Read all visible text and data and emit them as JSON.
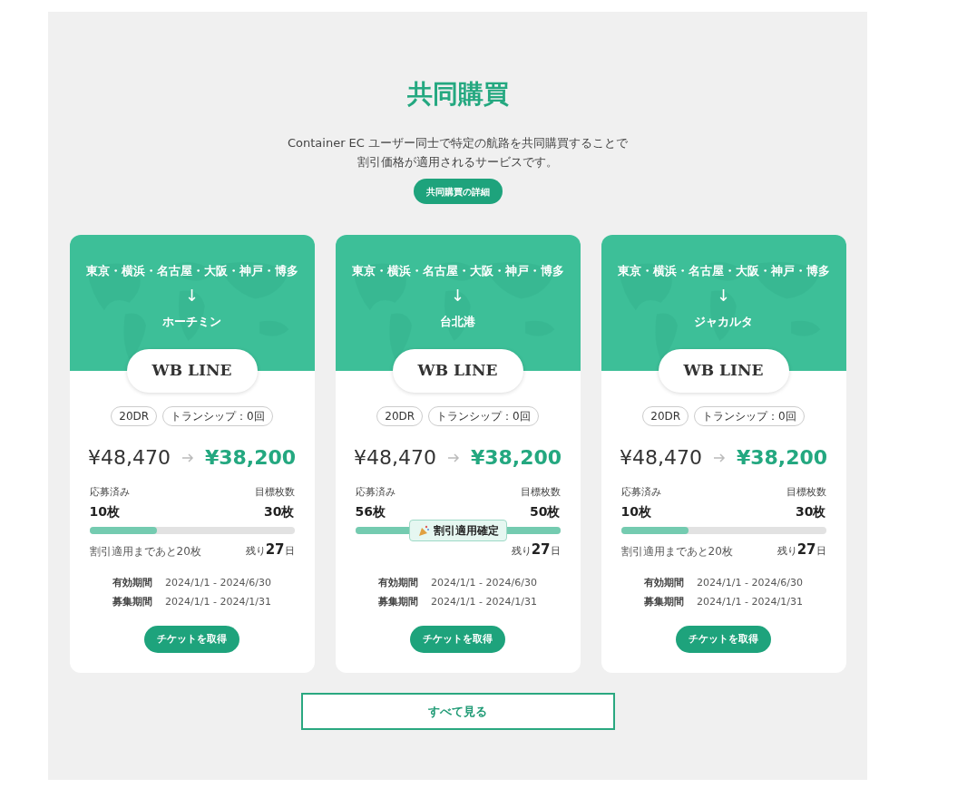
{
  "section": {
    "title": "共同購買",
    "description": [
      "Container EC ユーザー同士で特定の航路を共同購買することで",
      "割引価格が適用されるサービスです。"
    ],
    "detail_button": "共同購買の詳細"
  },
  "cards": [
    {
      "origin": "東京・横浜・名古屋・大阪・神戸・博多",
      "arrow": "↓",
      "destination": "ホーチミン",
      "carrier": "WB LINE",
      "tags": [
        "20DR",
        "トランシップ：0回"
      ],
      "original_price": "¥48,470",
      "discount_price": "¥38,200",
      "applied_label": "応募済み",
      "applied": "10枚",
      "target_label": "目標枚数",
      "target": "30枚",
      "level": 0.33,
      "confirmed": false,
      "remaining_note": "割引適用まであと20枚",
      "days_prefix": "残り",
      "days": "27",
      "days_suffix": "日",
      "periods": [
        {
          "label": "有効期間",
          "value": "2024/1/1 - 2024/6/30"
        },
        {
          "label": "募集期間",
          "value": "2024/1/1 - 2024/1/31"
        }
      ],
      "button": "チケットを取得"
    },
    {
      "origin": "東京・横浜・名古屋・大阪・神戸・博多",
      "arrow": "↓",
      "destination": "台北港",
      "carrier": "WB LINE",
      "tags": [
        "20DR",
        "トランシップ：0回"
      ],
      "original_price": "¥48,470",
      "discount_price": "¥38,200",
      "applied_label": "応募済み",
      "applied": "56枚",
      "target_label": "目標枚数",
      "target": "50枚",
      "level": 1,
      "confirmed": true,
      "confirmed_label": "割引適用確定",
      "days_prefix": "残り",
      "days": "27",
      "days_suffix": "日",
      "periods": [
        {
          "label": "有効期間",
          "value": "2024/1/1 - 2024/6/30"
        },
        {
          "label": "募集期間",
          "value": "2024/1/1 - 2024/1/31"
        }
      ],
      "button": "チケットを取得"
    },
    {
      "origin": "東京・横浜・名古屋・大阪・神戸・博多",
      "arrow": "↓",
      "destination": "ジャカルタ",
      "carrier": "WB LINE",
      "tags": [
        "20DR",
        "トランシップ：0回"
      ],
      "original_price": "¥48,470",
      "discount_price": "¥38,200",
      "applied_label": "応募済み",
      "applied": "10枚",
      "target_label": "目標枚数",
      "target": "30枚",
      "level": 0.33,
      "confirmed": false,
      "remaining_note": "割引適用まであと20枚",
      "days_prefix": "残り",
      "days": "27",
      "days_suffix": "日",
      "periods": [
        {
          "label": "有効期間",
          "value": "2024/1/1 - 2024/6/30"
        },
        {
          "label": "募集期間",
          "value": "2024/1/1 - 2024/1/31"
        }
      ],
      "button": "チケットを取得"
    }
  ],
  "see_all": "すべて見る"
}
